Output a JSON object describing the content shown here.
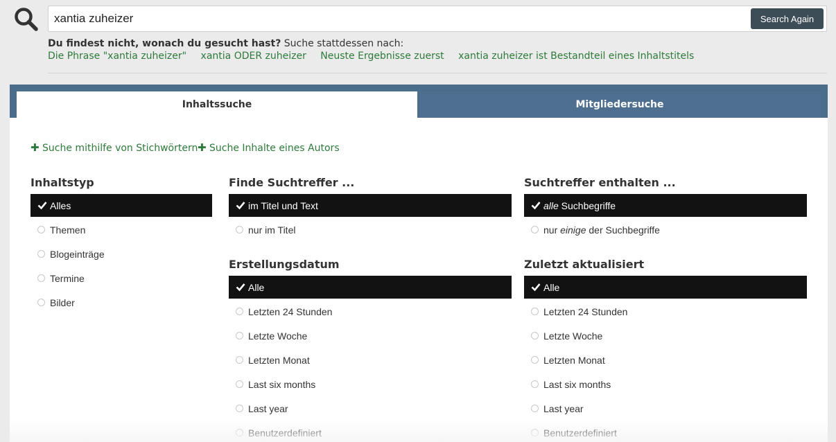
{
  "search": {
    "query": "xantia zuheizer",
    "button_label": "Search Again"
  },
  "suggestions": {
    "lead": "Du findest nicht, wonach du gesucht hast?",
    "rest": " Suche stattdessen nach:",
    "links": [
      "Die Phrase \"xantia zuheizer\"",
      "xantia ODER zuheizer",
      "Neuste Ergebnisse zuerst",
      "xantia zuheizer ist Bestandteil eines Inhaltstitels"
    ]
  },
  "tabs": {
    "content": "Inhaltssuche",
    "members": "Mitgliedersuche"
  },
  "advanced": {
    "keywords": "Suche mithilfe von Stichwörtern",
    "author": "Suche Inhalte eines Autors"
  },
  "content_type": {
    "title": "Inhaltstyp",
    "options": [
      "Alles",
      "Themen",
      "Blogeinträge",
      "Termine",
      "Bilder"
    ]
  },
  "find_in": {
    "title": "Finde Suchtreffer ...",
    "options": [
      "im Titel und Text",
      "nur im Titel"
    ]
  },
  "match": {
    "title": "Suchtreffer enthalten ...",
    "opt1_em": "alle",
    "opt1_rest": " Suchbegriffe",
    "opt2_pre": "nur ",
    "opt2_em": "einige",
    "opt2_rest": " der Suchbegriffe"
  },
  "created": {
    "title": "Erstellungsdatum",
    "options": [
      "Alle",
      "Letzten 24 Stunden",
      "Letzte Woche",
      "Letzten Monat",
      "Last six months",
      "Last year",
      "Benutzerdefiniert"
    ]
  },
  "updated": {
    "title": "Zuletzt aktualisiert",
    "options": [
      "Alle",
      "Letzten 24 Stunden",
      "Letzte Woche",
      "Letzten Monat",
      "Last six months",
      "Last year",
      "Benutzerdefiniert"
    ]
  },
  "colors": {
    "link_green": "#2d7a3a",
    "tab_bar": "#4a6d8c",
    "selected_bg": "#121212",
    "button_bg": "#3d4d57"
  }
}
